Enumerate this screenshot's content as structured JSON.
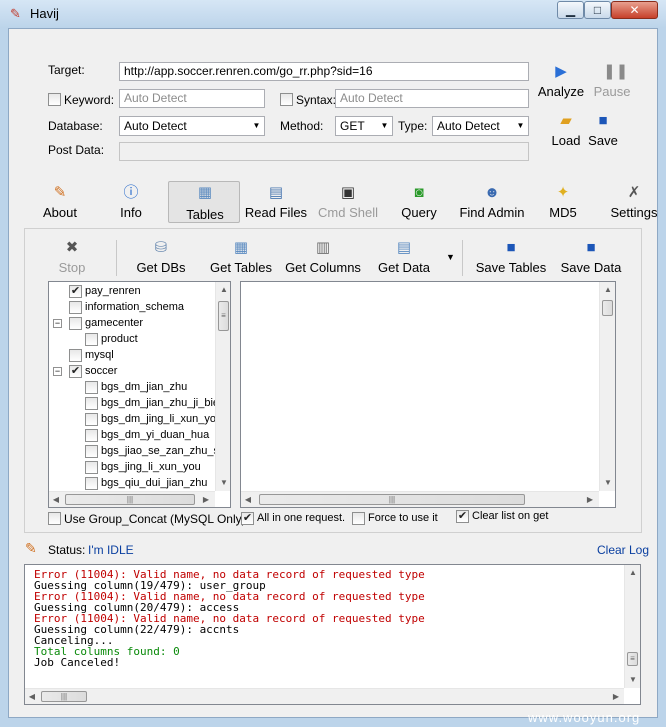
{
  "window": {
    "title": "Havij"
  },
  "form": {
    "target_label": "Target:",
    "target_value": "http://app.soccer.renren.com/go_rr.php?sid=16",
    "keyword_label": "Keyword:",
    "keyword_placeholder": "Auto Detect",
    "syntax_label": "Syntax:",
    "syntax_placeholder": "Auto Detect",
    "database_label": "Database:",
    "database_value": "Auto Detect",
    "method_label": "Method:",
    "method_value": "GET",
    "type_label": "Type:",
    "type_value": "Auto Detect",
    "postdata_label": "Post Data:"
  },
  "actions": {
    "analyze": "Analyze",
    "pause": "Pause",
    "load": "Load",
    "save": "Save"
  },
  "nav_tabs": [
    {
      "label": "About",
      "icon": "about-icon"
    },
    {
      "label": "Info",
      "icon": "info-icon"
    },
    {
      "label": "Tables",
      "icon": "tables-icon",
      "active": true
    },
    {
      "label": "Read Files",
      "icon": "read-files-icon"
    },
    {
      "label": "Cmd Shell",
      "icon": "cmd-shell-icon",
      "disabled": true
    },
    {
      "label": "Query",
      "icon": "query-icon"
    },
    {
      "label": "Find Admin",
      "icon": "find-admin-icon"
    },
    {
      "label": "MD5",
      "icon": "md5-icon"
    },
    {
      "label": "Settings",
      "icon": "settings-icon"
    }
  ],
  "tables_toolbar": {
    "stop": "Stop",
    "get_dbs": "Get DBs",
    "get_tables": "Get Tables",
    "get_columns": "Get Columns",
    "get_data": "Get Data",
    "save_tables": "Save Tables",
    "save_data": "Save Data"
  },
  "tree": [
    {
      "label": "pay_renren",
      "checked": true,
      "level": 0
    },
    {
      "label": "information_schema",
      "checked": false,
      "level": 0
    },
    {
      "label": "gamecenter",
      "checked": false,
      "level": 0,
      "expander": "−"
    },
    {
      "label": "product",
      "checked": false,
      "level": 1
    },
    {
      "label": "mysql",
      "checked": false,
      "level": 0
    },
    {
      "label": "soccer",
      "checked": true,
      "level": 0,
      "expander": "−"
    },
    {
      "label": "bgs_dm_jian_zhu",
      "checked": false,
      "level": 1
    },
    {
      "label": "bgs_dm_jian_zhu_ji_bie",
      "checked": false,
      "level": 1
    },
    {
      "label": "bgs_dm_jing_li_xun_you",
      "checked": false,
      "level": 1
    },
    {
      "label": "bgs_dm_yi_duan_hua",
      "checked": false,
      "level": 1
    },
    {
      "label": "bgs_jiao_se_zan_zhu_s",
      "checked": false,
      "level": 1
    },
    {
      "label": "bgs_jing_li_xun_you",
      "checked": false,
      "level": 1
    },
    {
      "label": "bgs_qiu_dui_jian_zhu",
      "checked": false,
      "level": 1
    }
  ],
  "options": {
    "group_concat": {
      "label": "Use Group_Concat (MySQL Only)",
      "checked": false
    },
    "all_in_one": {
      "label": "All in one request.",
      "checked": true
    },
    "force": {
      "label": "Force to use it",
      "checked": false
    },
    "clear_list": {
      "label": "Clear list on get",
      "checked": true
    }
  },
  "status": {
    "label": "Status:",
    "value": "I'm IDLE",
    "clear_log": "Clear Log"
  },
  "log": [
    {
      "text": "Error (11004): Valid name, no data record of requested type",
      "color": "#c00000"
    },
    {
      "text": "Guessing column(19/479): user_group",
      "color": "#000000"
    },
    {
      "text": "Error (11004): Valid name, no data record of requested type",
      "color": "#c00000"
    },
    {
      "text": "Guessing column(20/479): access",
      "color": "#000000"
    },
    {
      "text": "Error (11004): Valid name, no data record of requested type",
      "color": "#c00000"
    },
    {
      "text": "Guessing column(22/479): accnts",
      "color": "#000000"
    },
    {
      "text": "Canceling...",
      "color": "#000000"
    },
    {
      "text": "Total columns found: 0",
      "color": "#0a8a0a"
    },
    {
      "text": "Job Canceled!",
      "color": "#000000"
    }
  ],
  "watermark": "www.wooyun.org"
}
